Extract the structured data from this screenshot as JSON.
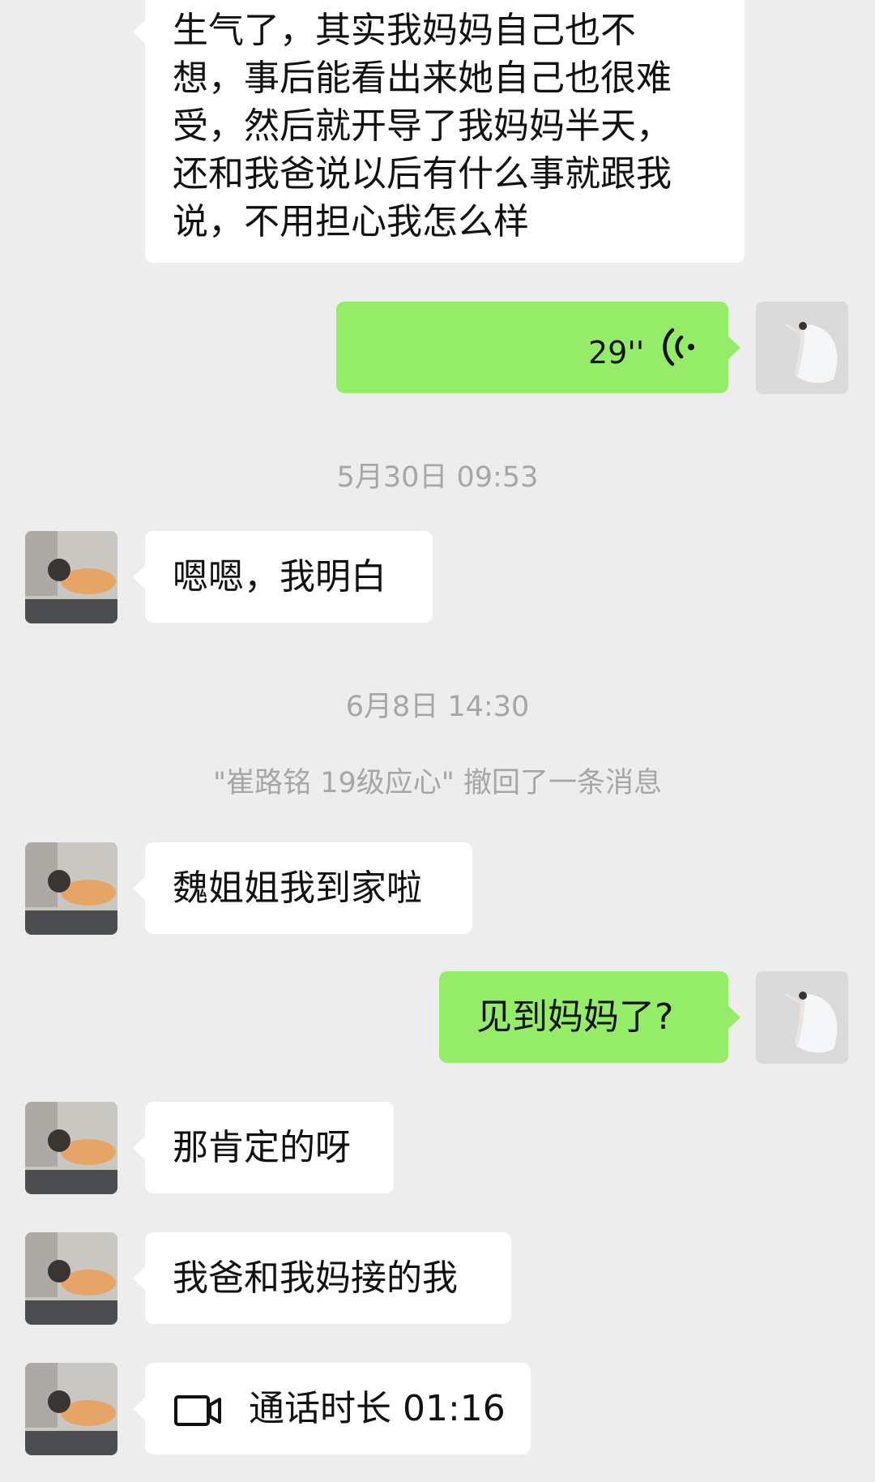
{
  "messages": {
    "m1_lines": [
      "生气了，其实我妈妈自己也不",
      "想，事后能看出来她自己也很难",
      "受，然后就开导了我妈妈半天，",
      "还和我爸说以后有什么事就跟我",
      "说，不用担心我怎么样"
    ],
    "voice_duration": "29''",
    "ts1": "5月30日 09:53",
    "m2": "嗯嗯，我明白",
    "ts2": "6月8日 14:30",
    "recall_notice": "\"崔路铭 19级应心\" 撤回了一条消息",
    "m3": "魏姐姐我到家啦",
    "m4": "见到妈妈了?",
    "m5": "那肯定的呀",
    "m6": "我爸和我妈接的我",
    "call_label": "通话时长 01:16"
  },
  "icons": {
    "voice": "voice-wave-icon",
    "video_call": "video-camera-icon",
    "avatar_left": "avatar-person-cat",
    "avatar_right": "avatar-dancer"
  },
  "colors": {
    "background": "#ededed",
    "bubble_in": "#ffffff",
    "bubble_out": "#95ec69",
    "meta_text": "#a6a6a6"
  }
}
